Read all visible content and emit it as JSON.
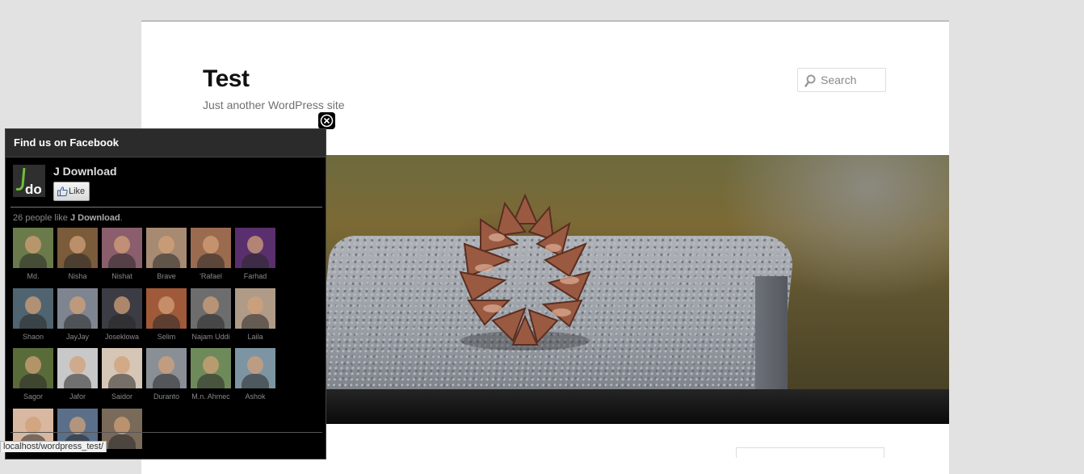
{
  "site": {
    "title": "Test",
    "description": "Just another WordPress site"
  },
  "search": {
    "placeholder": "Search",
    "icon": "search-icon"
  },
  "facebook_box": {
    "heading": "Find us on Facebook",
    "close_icon": "close-icon",
    "page_name": "J Download",
    "logo_text": "do",
    "like_label": "Like",
    "like_count_text": "26 people like",
    "like_count_page": "J Download",
    "like_count_suffix": ".",
    "fans": [
      {
        "name": "Md.",
        "color": "#6b7a4a"
      },
      {
        "name": "Nisha",
        "color": "#7a5b3a"
      },
      {
        "name": "Nishat",
        "color": "#8a5e6c"
      },
      {
        "name": "Brave",
        "color": "#a68a72"
      },
      {
        "name": "'Rafael",
        "color": "#9b6b4f"
      },
      {
        "name": "Farhad",
        "color": "#5a2f6e"
      },
      {
        "name": "Shaon",
        "color": "#4f6470"
      },
      {
        "name": "JayJay",
        "color": "#7f8590"
      },
      {
        "name": "Joseklowa",
        "color": "#3c3c44"
      },
      {
        "name": "Selim",
        "color": "#a05a3a"
      },
      {
        "name": "Najam Uddi",
        "color": "#6d6d6d"
      },
      {
        "name": "Laila",
        "color": "#b09a88"
      },
      {
        "name": "Sagor",
        "color": "#5a6b3a"
      },
      {
        "name": "Jafor",
        "color": "#c8c8c8"
      },
      {
        "name": "Saidor",
        "color": "#d6c6b6"
      },
      {
        "name": "Duranto",
        "color": "#8a8f96"
      },
      {
        "name": "M.n. Ahmec",
        "color": "#6f8a5a"
      },
      {
        "name": "Ashok",
        "color": "#7d94a3"
      },
      {
        "name": "",
        "color": "#d8b8a0"
      },
      {
        "name": "",
        "color": "#5a6f8a"
      },
      {
        "name": "",
        "color": "#7a6a5a"
      }
    ]
  },
  "statusbar": {
    "url": "localhost/wordpress_test/"
  },
  "colors": {
    "page_background": "#e2e2e2",
    "fb_panel_background": "#000000",
    "nav_bar": "#1a1a1a"
  }
}
